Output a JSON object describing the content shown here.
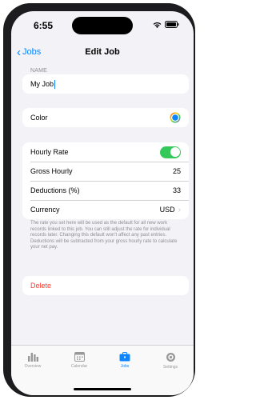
{
  "status": {
    "time": "6:55"
  },
  "nav": {
    "back_label": "Jobs",
    "title": "Edit Job"
  },
  "name_section": {
    "label": "NAME",
    "value": "My Job"
  },
  "color_row": {
    "label": "Color",
    "accent": "#0a84ff"
  },
  "rate_section": {
    "hourly_rate": {
      "label": "Hourly Rate",
      "enabled": true
    },
    "gross_hourly": {
      "label": "Gross Hourly",
      "value": "25"
    },
    "deductions": {
      "label": "Deductions (%)",
      "value": "33"
    },
    "currency": {
      "label": "Currency",
      "value": "USD"
    }
  },
  "footnote": "The rate you set here will be used as the default for all new work records linked to this job. You can still adjust the rate for individual records later. Changing this default won't affect any past entries. Deductions will be subtracted from your gross hourly rate to calculate your net pay.",
  "delete": {
    "label": "Delete",
    "color": "#ff3b30"
  },
  "tabs": [
    {
      "label": "Overview",
      "icon": "chart-bars-icon"
    },
    {
      "label": "Calendar",
      "icon": "calendar-icon"
    },
    {
      "label": "Jobs",
      "icon": "briefcase-icon",
      "active": true
    },
    {
      "label": "Settings",
      "icon": "gear-icon"
    }
  ],
  "colors": {
    "accent": "#0a84ff",
    "toggle_on": "#34c759",
    "background": "#f2f2f7"
  }
}
